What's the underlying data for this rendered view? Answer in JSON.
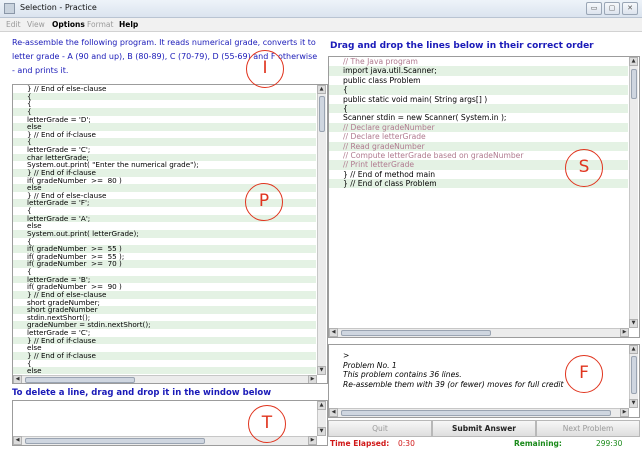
{
  "window": {
    "title": "Selection - Practice",
    "controls": [
      "▭",
      "▢",
      "✕"
    ]
  },
  "menu": [
    {
      "label": "Edit",
      "enabled": false
    },
    {
      "label": "View",
      "enabled": false
    },
    {
      "label": "Options",
      "enabled": true
    },
    {
      "label": "Format",
      "enabled": false
    },
    {
      "label": "Help",
      "enabled": true
    }
  ],
  "instructions": {
    "line1": "Re-assemble the following program. It reads numerical grade, converts it to",
    "line2": "letter grade - A (90 and up), B (80-89), C (70-79), D (55-69) and F otherwise",
    "line3": "- and prints it."
  },
  "program_lines": [
    "} // End of else-clause",
    "{",
    "{",
    "{",
    "letterGrade = 'D';",
    "else",
    "} // End of if-clause",
    "{",
    "letterGrade = 'C';",
    "char letterGrade;",
    "System.out.print( \"Enter the numerical grade\");",
    "} // End of if-clause",
    "if( gradeNumber  >=  80 )",
    "else",
    "} // End of else-clause",
    "letterGrade = 'F';",
    "{",
    "letterGrade = 'A';",
    "else",
    "System.out.print( letterGrade);",
    "{",
    "if( gradeNumber  >=  55 )",
    "if( gradeNumber  >=  55 );",
    "if( gradeNumber  >=  70 )",
    "{",
    "letterGrade = 'B';",
    "if( gradeNumber  >=  90 )",
    "} // End of else-clause",
    "short gradeNumber;",
    "short gradeNumber",
    "stdin.nextShort();",
    "gradeNumber = stdin.nextShort();",
    "letterGrade = 'C';",
    "} // End of if-clause",
    "else",
    "} // End of if-clause",
    "{",
    "else"
  ],
  "delete_label": "To delete a line, drag and drop it in the window below",
  "drag_label": "Drag and drop the lines below in their correct order",
  "source_lines": [
    {
      "text": "// The Java program",
      "comment": true
    },
    {
      "text": "import java.util.Scanner;",
      "comment": false
    },
    {
      "text": "public class Problem",
      "comment": false
    },
    {
      "text": "{",
      "comment": false
    },
    {
      "text": "public static void main( String args[] )",
      "comment": false
    },
    {
      "text": "{",
      "comment": false
    },
    {
      "text": "Scanner stdin = new Scanner( System.in );",
      "comment": false
    },
    {
      "text": "// Declare gradeNumber",
      "comment": true
    },
    {
      "text": "// Declare letterGrade",
      "comment": true
    },
    {
      "text": "// Read gradeNumber",
      "comment": true
    },
    {
      "text": "// Compute letterGrade based on gradeNumber",
      "comment": true
    },
    {
      "text": "// Print letterGrade",
      "comment": true
    },
    {
      "text": "} // End of method main",
      "comment": false
    },
    {
      "text": "} // End of class Problem",
      "comment": false
    }
  ],
  "feedback": {
    "prompt": ">",
    "line1": "Problem No. 1",
    "line2": "This problem contains 36 lines.",
    "line3": "Re-assemble them with 39 (or fewer) moves for full credit"
  },
  "buttons": {
    "quit": "Quit",
    "submit": "Submit Answer",
    "next": "Next Problem"
  },
  "status": {
    "elapsed_label": "Time Elapsed:",
    "elapsed_value": "0:30",
    "remaining_label": "Remaining:",
    "remaining_value": "299:30"
  },
  "annotations": {
    "I": "I",
    "P": "P",
    "T": "T",
    "S": "S",
    "F": "F"
  },
  "colors": {
    "instruction_blue": "#1a1ab8",
    "row_green": "#e4f2e4",
    "comment_pink": "#b07a8f",
    "elapsed_red": "#d01818",
    "remaining_green": "#1a8a1a",
    "annotation_red": "#e0341e"
  }
}
